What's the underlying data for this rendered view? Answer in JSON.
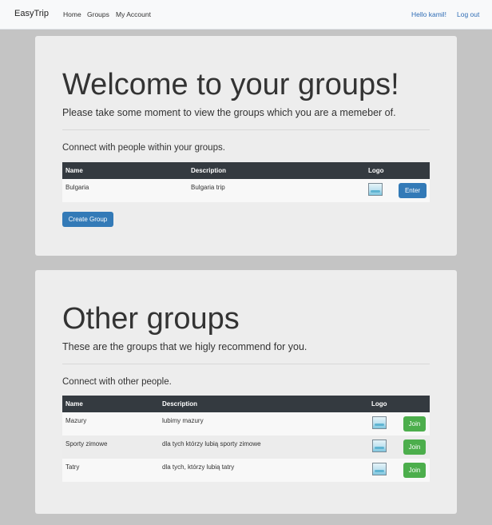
{
  "navbar": {
    "brand": "EasyTrip",
    "links": [
      "Home",
      "Groups",
      "My Account"
    ],
    "greeting": "Hello kamil!",
    "logout": "Log out"
  },
  "my_groups": {
    "title": "Welcome to your groups!",
    "lead": "Please take some moment to view the groups which you are a memeber of.",
    "subtitle": "Connect with people within your groups.",
    "columns": [
      "Name",
      "Description",
      "Logo"
    ],
    "rows": [
      {
        "name": "Bulgaria",
        "description": "Bulgaria trip",
        "action": "Enter"
      }
    ],
    "create_button": "Create Group"
  },
  "other_groups": {
    "title": "Other groups",
    "lead": "These are the groups that we higly recommend for you.",
    "subtitle": "Connect with other people.",
    "columns": [
      "Name",
      "Description",
      "Logo"
    ],
    "rows": [
      {
        "name": "Mazury",
        "description": "lubimy mazury",
        "action": "Join"
      },
      {
        "name": "Sporty zimowe",
        "description": "dla tych którzy lubią sporty zimowe",
        "action": "Join"
      },
      {
        "name": "Tatry",
        "description": "dla tych, którzy lubią tatry",
        "action": "Join"
      }
    ]
  },
  "colors": {
    "navbar_bg": "#f8f9fa",
    "page_bg": "#c4c4c4",
    "table_header": "#343a40",
    "primary_button": "#337ab7",
    "success_button": "#4cae4c"
  }
}
